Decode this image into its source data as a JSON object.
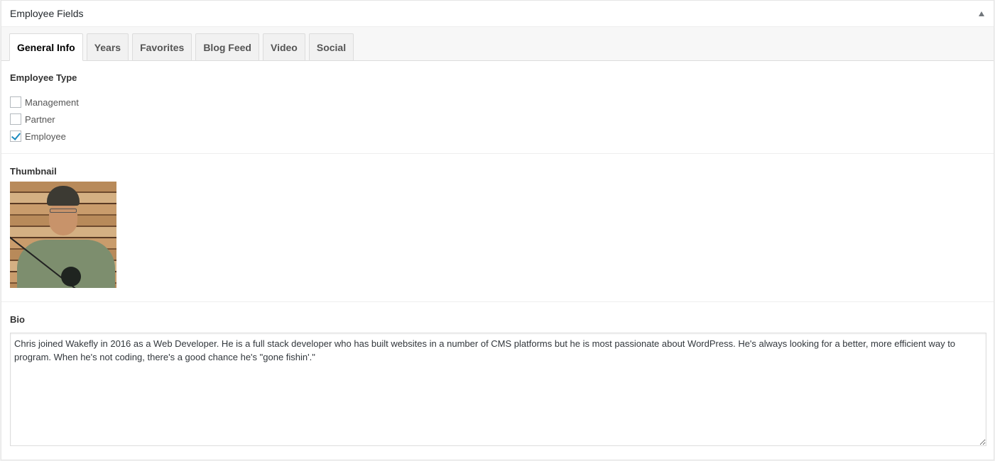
{
  "panel": {
    "title": "Employee Fields",
    "toggle_icon": "triangle-up-icon"
  },
  "tabs": [
    {
      "label": "General Info",
      "active": true
    },
    {
      "label": "Years",
      "active": false
    },
    {
      "label": "Favorites",
      "active": false
    },
    {
      "label": "Blog Feed",
      "active": false
    },
    {
      "label": "Video",
      "active": false
    },
    {
      "label": "Social",
      "active": false
    }
  ],
  "employee_type": {
    "label": "Employee Type",
    "options": [
      {
        "label": "Management",
        "checked": false
      },
      {
        "label": "Partner",
        "checked": false
      },
      {
        "label": "Employee",
        "checked": true
      }
    ]
  },
  "thumbnail": {
    "label": "Thumbnail",
    "alt": "Photo of a man in a cap holding a fishing rod"
  },
  "bio": {
    "label": "Bio",
    "value": "Chris joined Wakefly in 2016 as a Web Developer. He is a full stack developer who has built websites in a number of CMS platforms but he is most passionate about WordPress. He's always looking for a better, more efficient way to program. When he's not coding, there's a good chance he's \"gone fishin'.\""
  }
}
